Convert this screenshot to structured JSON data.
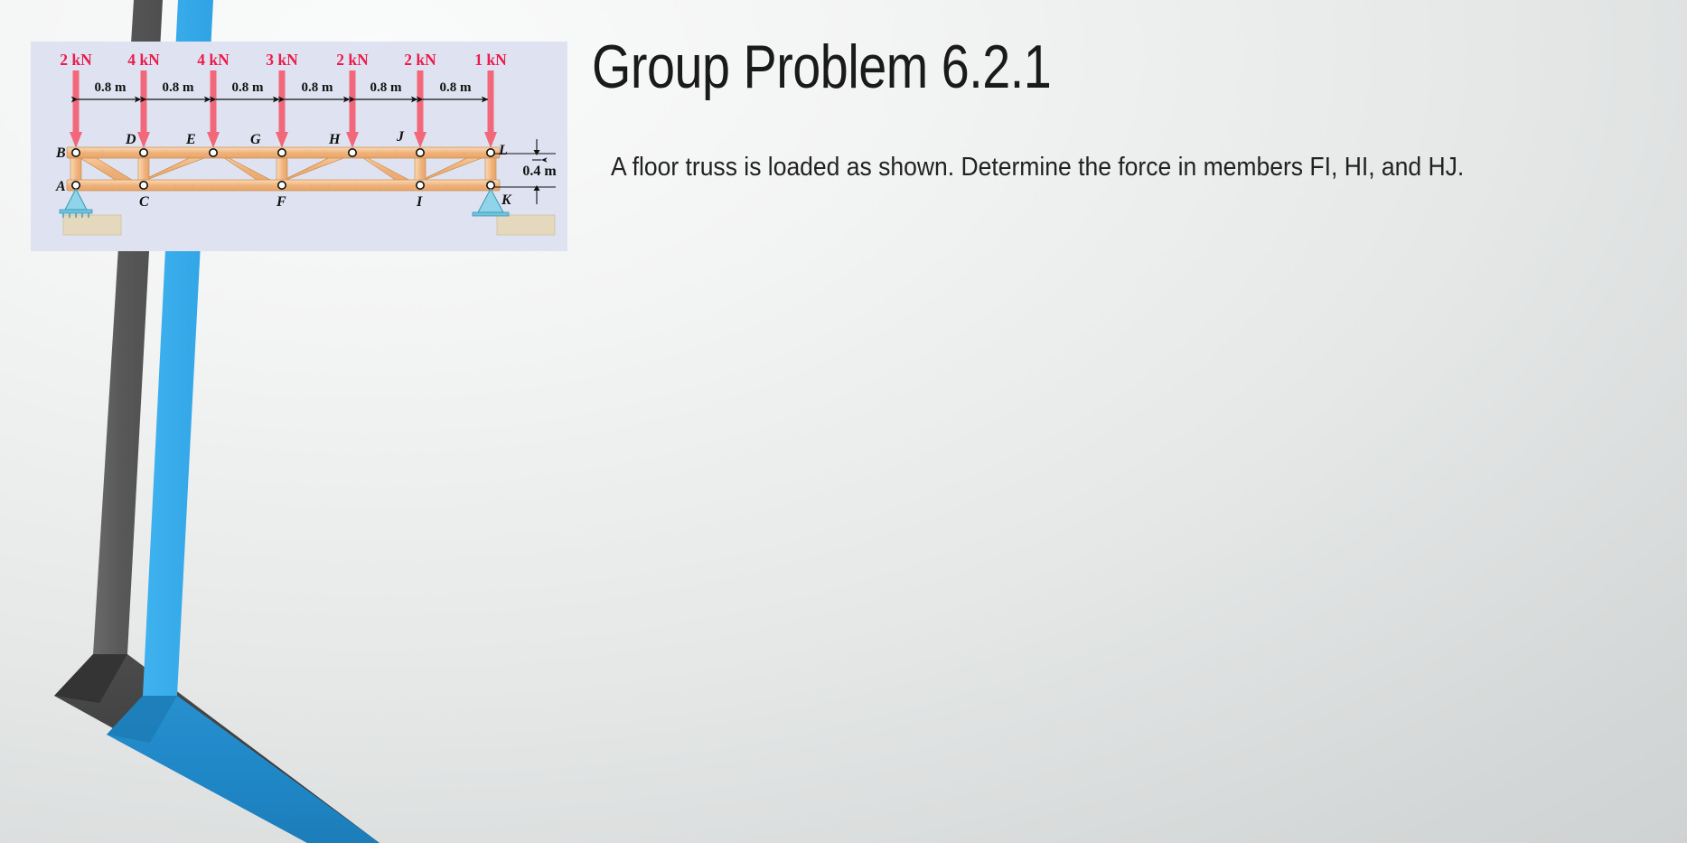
{
  "slide": {
    "title": "Group Problem 6.2.1",
    "body_text": "A floor truss is loaded as shown. Determine the force in members FI, HI, and HJ.",
    "background_color": "#eceeee",
    "accent_blue": "#34a9e8",
    "accent_dark": "#565656"
  },
  "figure": {
    "caption_alt": "floor-truss-diagram",
    "background_color": "#dfe3f1",
    "load_color": "#f2687a",
    "member_color": "#f4c08a",
    "loads": [
      {
        "label": "2 kN",
        "node": "B"
      },
      {
        "label": "4 kN",
        "node": "D"
      },
      {
        "label": "4 kN",
        "node": "E"
      },
      {
        "label": "3 kN",
        "node": "G"
      },
      {
        "label": "2 kN",
        "node": "H"
      },
      {
        "label": "2 kN",
        "node": "J"
      },
      {
        "label": "1 kN",
        "node": "L"
      }
    ],
    "span_dimensions": [
      "0.8 m",
      "0.8 m",
      "0.8 m",
      "0.8 m",
      "0.8 m",
      "0.8 m"
    ],
    "height_dimension": "0.4 m",
    "top_chord_nodes": [
      "B",
      "D",
      "E",
      "G",
      "H",
      "J",
      "L"
    ],
    "bottom_chord_nodes": [
      "A",
      "C",
      "F",
      "I",
      "K"
    ],
    "supports": [
      {
        "node": "A",
        "type": "rocker"
      },
      {
        "node": "K",
        "type": "pin"
      }
    ]
  }
}
